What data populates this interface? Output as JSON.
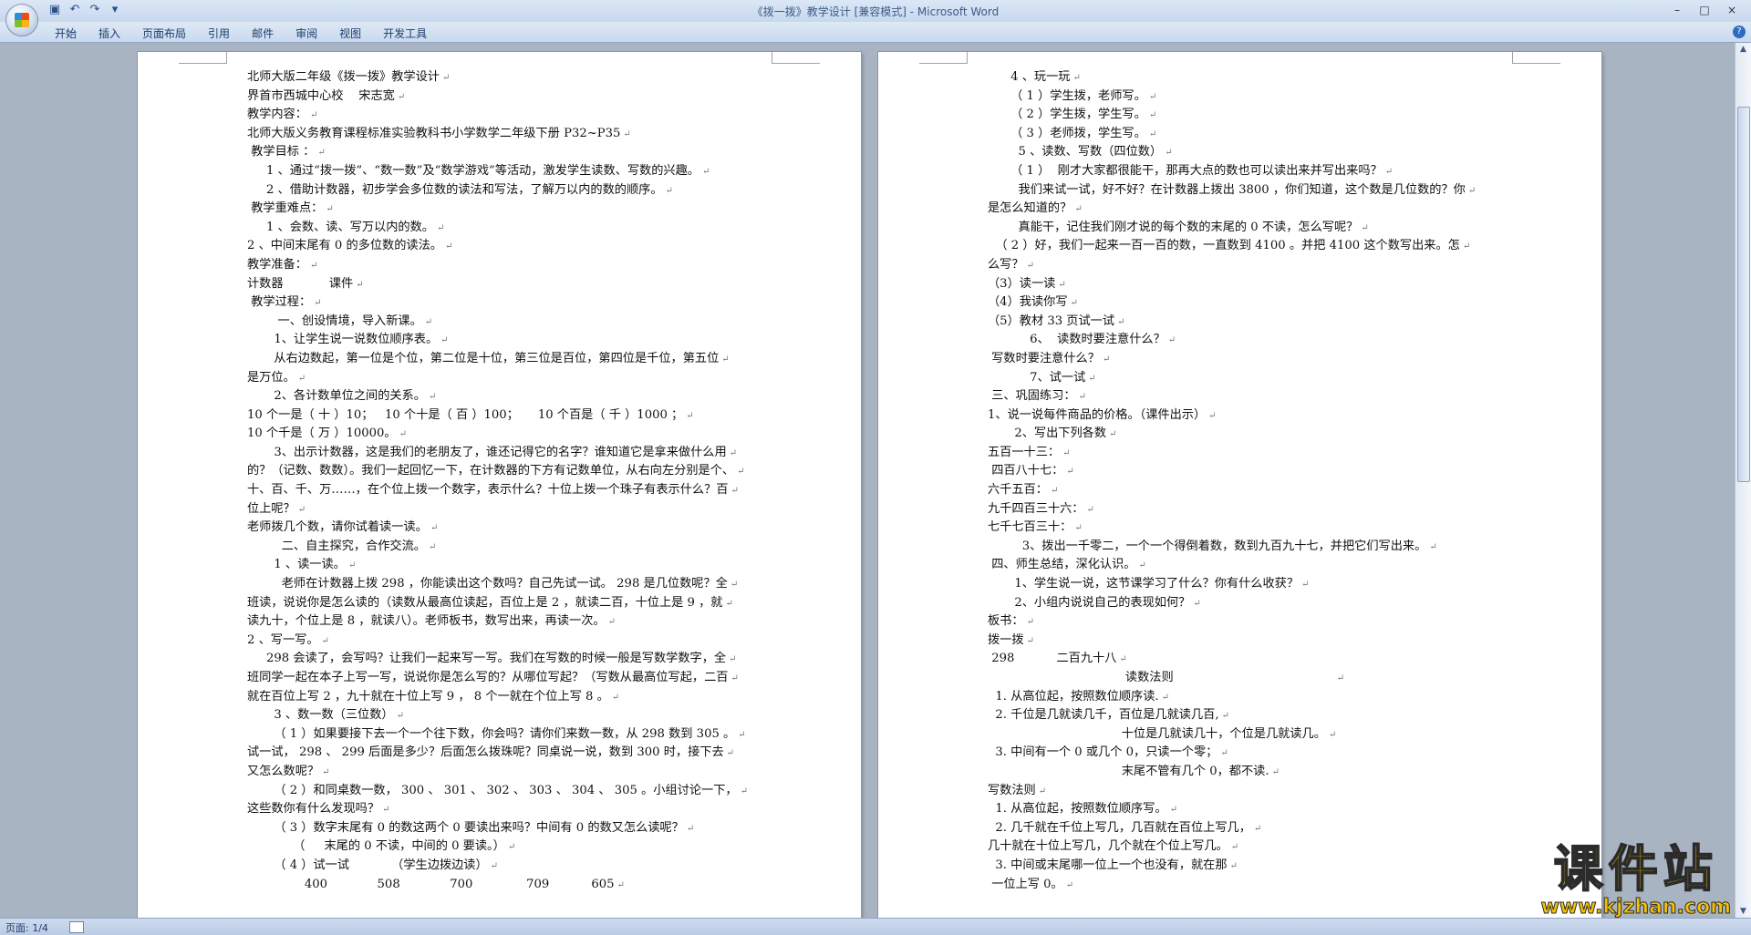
{
  "window": {
    "title": "《拨一拨》教学设计 [兼容模式] - Microsoft Word",
    "controls": [
      "–",
      "□",
      "×"
    ]
  },
  "quick_access": [
    "save-icon",
    "undo-icon",
    "redo-icon",
    "customize-icon"
  ],
  "ribbon": {
    "tabs": [
      "开始",
      "插入",
      "页面布局",
      "引用",
      "邮件",
      "审阅",
      "视图",
      "开发工具"
    ]
  },
  "status": {
    "page": "页面: 1/4"
  },
  "watermark": {
    "main": "课件站",
    "url": "www.kjzhan.com"
  },
  "page1": {
    "lines": [
      "北师大版二年级《拨一拨》教学设计",
      "界首市西城中心校    宋志宽",
      "教学内容：",
      "北师大版义务教育课程标准实验教科书小学数学二年级下册 P32~P35",
      " 教学目标 ：",
      "     1 、通过“拨一拨”、“数一数”及“数学游戏”等活动，激发学生读数、写数的兴趣。",
      "     2 、借助计数器，初步学会多位数的读法和写法，了解万以内的数的顺序。",
      " 教学重难点：",
      "     1 、会数、读、写万以内的数。",
      "2 、中间末尾有 0 的多位数的读法。",
      "教学准备：",
      "计数器            课件",
      " 教学过程：",
      "        一、创设情境，导入新课。",
      "       1、让学生说一说数位顺序表。",
      "       从右边数起，第一位是个位，第二位是十位，第三位是百位，第四位是千位，第五位",
      "是万位。",
      "       2、各计数单位之间的关系。",
      "10 个一是（ 十 ）10；   10 个十是（ 百 ）100；     10 个百是（ 千 ）1000 ；",
      "10 个千是（ 万 ）10000。",
      "       3、出示计数器，这是我们的老朋友了，谁还记得它的名字？谁知道它是拿来做什么用",
      "的？（记数、数数）。我们一起回忆一下，在计数器的下方有记数单位，从右向左分别是个、",
      "十、百、千、万……，在个位上拨一个数字，表示什么？十位上拨一个珠子有表示什么？百",
      "位上呢？",
      "老师拨几个数，请你试着读一读。",
      "         二、自主探究，合作交流。",
      "       1 、读一读。",
      "         老师在计数器上拨 298 ，你能读出这个数吗？自己先试一试。 298 是几位数呢？全",
      "班读，说说你是怎么读的（读数从最高位读起，百位上是 2 ，就读二百，十位上是 9 ，就",
      "读九十，个位上是 8 ，就读八）。老师板书，数写出来，再读一次。",
      "2 、写一写。",
      "     298 会读了，会写吗？让我们一起来写一写。我们在写数的时候一般是写数学数字，全",
      "班同学一起在本子上写一写，说说你是怎么写的？从哪位写起？（写数从最高位写起，二百",
      "就在百位上写 2 ，九十就在十位上写 9 ， 8 个一就在个位上写 8 。",
      "       3 、数一数（三位数）",
      "       （ 1 ）如果要接下去一个一个往下数，你会吗？请你们来数一数，从 298 数到 305 。",
      "试一试， 298 、 299 后面是多少？后面怎么拨珠呢？同桌说一说，数到 300 时，接下去",
      "又怎么数呢？",
      "       （ 2 ）和同桌数一数， 300 、 301 、 302 、 303 、 304 、 305 。小组讨论一下，",
      "这些数你有什么发现吗？",
      "       （ 3 ）数字末尾有 0 的数这两个 0 要读出来吗？中间有 0 的数又怎么读呢？",
      "            （     末尾的 0 不读，中间的 0 要读。）",
      "       （ 4 ）试一试           （学生边拨边读）",
      "               400             508             700              709           605"
    ]
  },
  "page2": {
    "lines": [
      "      4 、玩一玩",
      "      （ 1 ）学生拨，老师写。",
      "      （ 2 ）学生拨，学生写。",
      "      （ 3 ）老师拨，学生写。",
      "        5 、读数、写数（四位数）",
      "      （ 1 ）  刚才大家都很能干，那再大点的数也可以读出来并写出来吗？",
      "        我们来试一试，好不好？在计数器上拨出 3800 ，你们知道，这个数是几位数的？你",
      "是怎么知道的？",
      "        真能干，记住我们刚才说的每个数的末尾的 0 不读，怎么写呢？",
      "  （ 2 ）好，我们一起来一百一百的数，一直数到 4100 。并把 4100 这个数写出来。怎",
      "么写？",
      "（3）读一读",
      "（4）我读你写",
      "（5）教材 33 页试一试",
      "           6、  读数时要注意什么？",
      " 写数时要注意什么？",
      "           7、试一试",
      " 三、巩固练习：",
      "1、说一说每件商品的价格。（课件出示）",
      "       2、写出下列各数",
      "五百一十三：",
      " 四百八十七：",
      "六千五百：",
      "九千四百三十六：",
      "七千七百三十：",
      "         3、拨出一千零二，一个一个得倒着数，数到九百九十七，并把它们写出来。",
      " 四、师生总结，深化认识。",
      "       1、学生说一说，这节课学习了什么？你有什么收获？",
      "       2、小组内说说自己的表现如何？",
      "板书：",
      "拨一拨",
      " 298           二百九十八",
      "                                    读数法则                                          ",
      "  1. 从高位起，按照数位顺序读.",
      "  2. 千位是几就读几千，百位是几就读几百,",
      "                                   十位是几就读几十，个位是几就读几。",
      "  3. 中间有一个 0 或几个 0，只读一个零；",
      "                                   末尾不管有几个 0，都不读.",
      "写数法则",
      "  1. 从高位起，按照数位顺序写。",
      "  2. 几千就在千位上写几，几百就在百位上写几，",
      "几十就在十位上写几，几个就在个位上写几。",
      "  3. 中间或末尾哪一位上一个也没有，就在那",
      " 一位上写 0。"
    ]
  }
}
